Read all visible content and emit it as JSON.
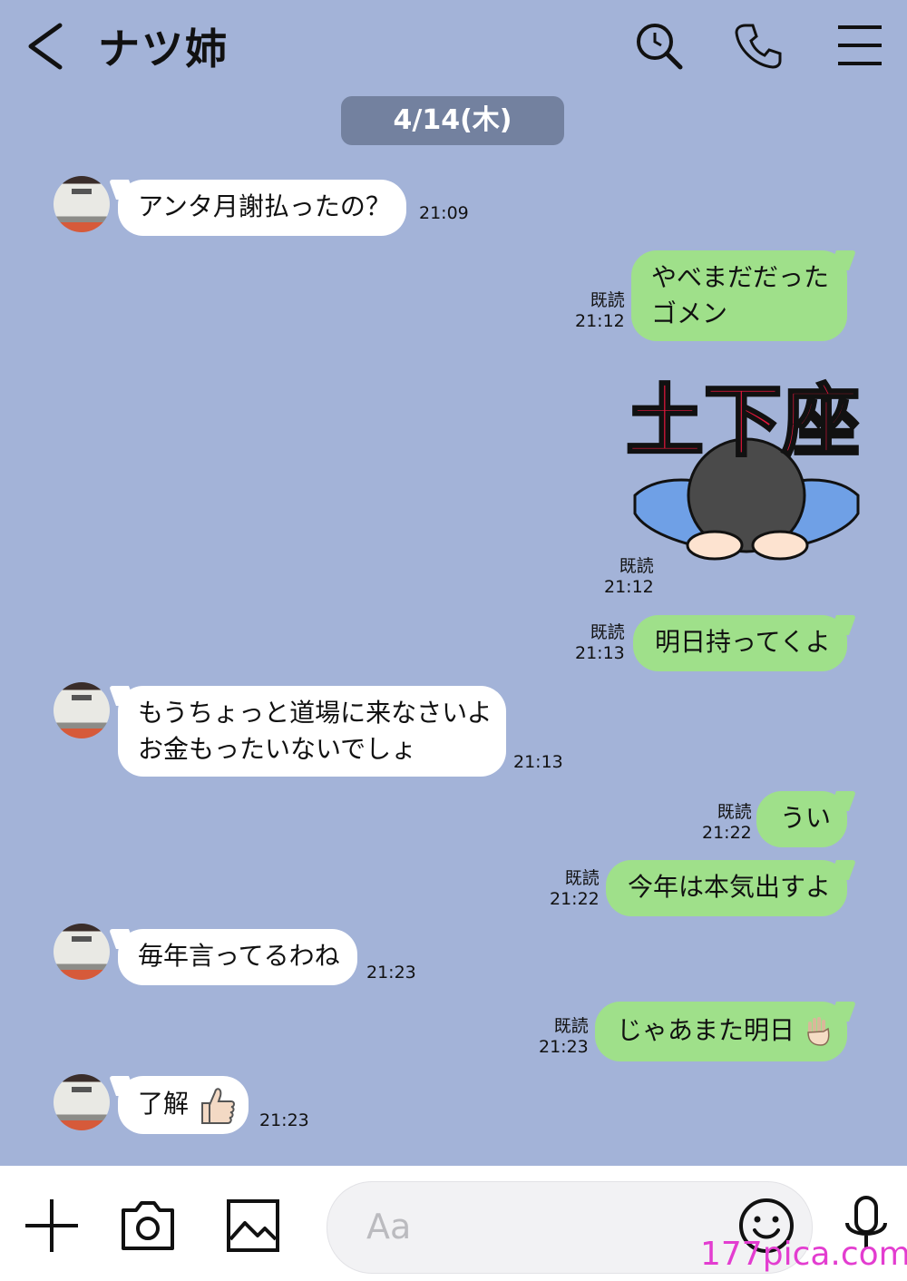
{
  "header": {
    "title": "ナツ姉",
    "icons": [
      "back-icon",
      "search-icon",
      "phone-icon",
      "menu-icon"
    ]
  },
  "date_separator": "4/14(木)",
  "messages": [
    {
      "side": "in",
      "text": "アンタ月謝払ったの？",
      "time": "21:09"
    },
    {
      "side": "out",
      "lines": [
        "やべまだだった",
        "ゴメン"
      ],
      "read": "既読",
      "time": "21:12"
    },
    {
      "side": "out",
      "sticker": "土下座",
      "read": "既読",
      "time": "21:12"
    },
    {
      "side": "out",
      "text": "明日持ってくよ",
      "read": "既読",
      "time": "21:13"
    },
    {
      "side": "in",
      "lines": [
        "もうちょっと道場に来なさいよ",
        "お金もったいないでしょ"
      ],
      "time": "21:13"
    },
    {
      "side": "out",
      "text": "うい",
      "read": "既読",
      "time": "21:22"
    },
    {
      "side": "out",
      "text": "今年は本気出すよ",
      "read": "既読",
      "time": "21:22"
    },
    {
      "side": "in",
      "text": "毎年言ってるわね",
      "time": "21:23"
    },
    {
      "side": "out",
      "text": "じゃあまた明日",
      "emoji": "waving-hand-icon",
      "read": "既読",
      "time": "21:23"
    },
    {
      "side": "in",
      "text": "了解",
      "emoji": "thumbs-up-icon",
      "time": "21:23"
    }
  ],
  "input": {
    "placeholder": "Aa"
  },
  "bottom_icons": [
    "plus-icon",
    "camera-icon",
    "image-icon",
    "emoji-icon",
    "mic-icon"
  ],
  "watermark": "177pica.com",
  "colors": {
    "background": "#a3b3d8",
    "outgoing": "#9fe08a",
    "incoming": "#ffffff",
    "date_pill": "#73819f",
    "sticker_text": "#e8173c"
  }
}
